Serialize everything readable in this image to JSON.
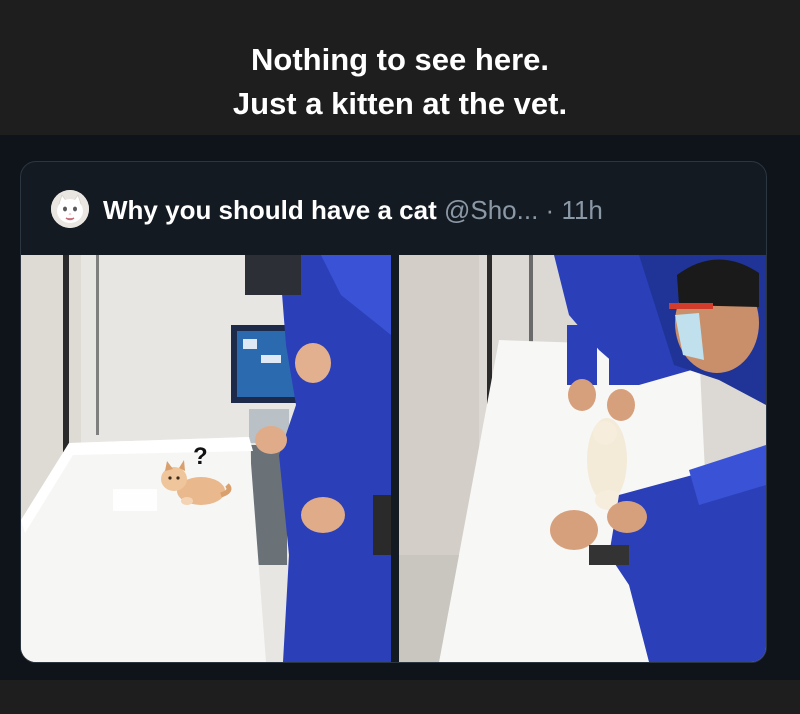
{
  "caption": {
    "line1": "Nothing to see here.",
    "line2": "Just a kitten at the vet."
  },
  "post": {
    "author_name": "Why you should have a cat",
    "handle": "@Sho...",
    "separator": "·",
    "time": "11h",
    "left_photo": {
      "overlay_text": "?"
    }
  },
  "colors": {
    "page_background": "#1e1e1f",
    "post_background": "#131a22",
    "caption_text": "#ffffff",
    "secondary_text": "#8b98a5",
    "vet_gown_blue": "#2b3fb8"
  },
  "icons": {
    "avatar": "white-cat-avatar"
  }
}
